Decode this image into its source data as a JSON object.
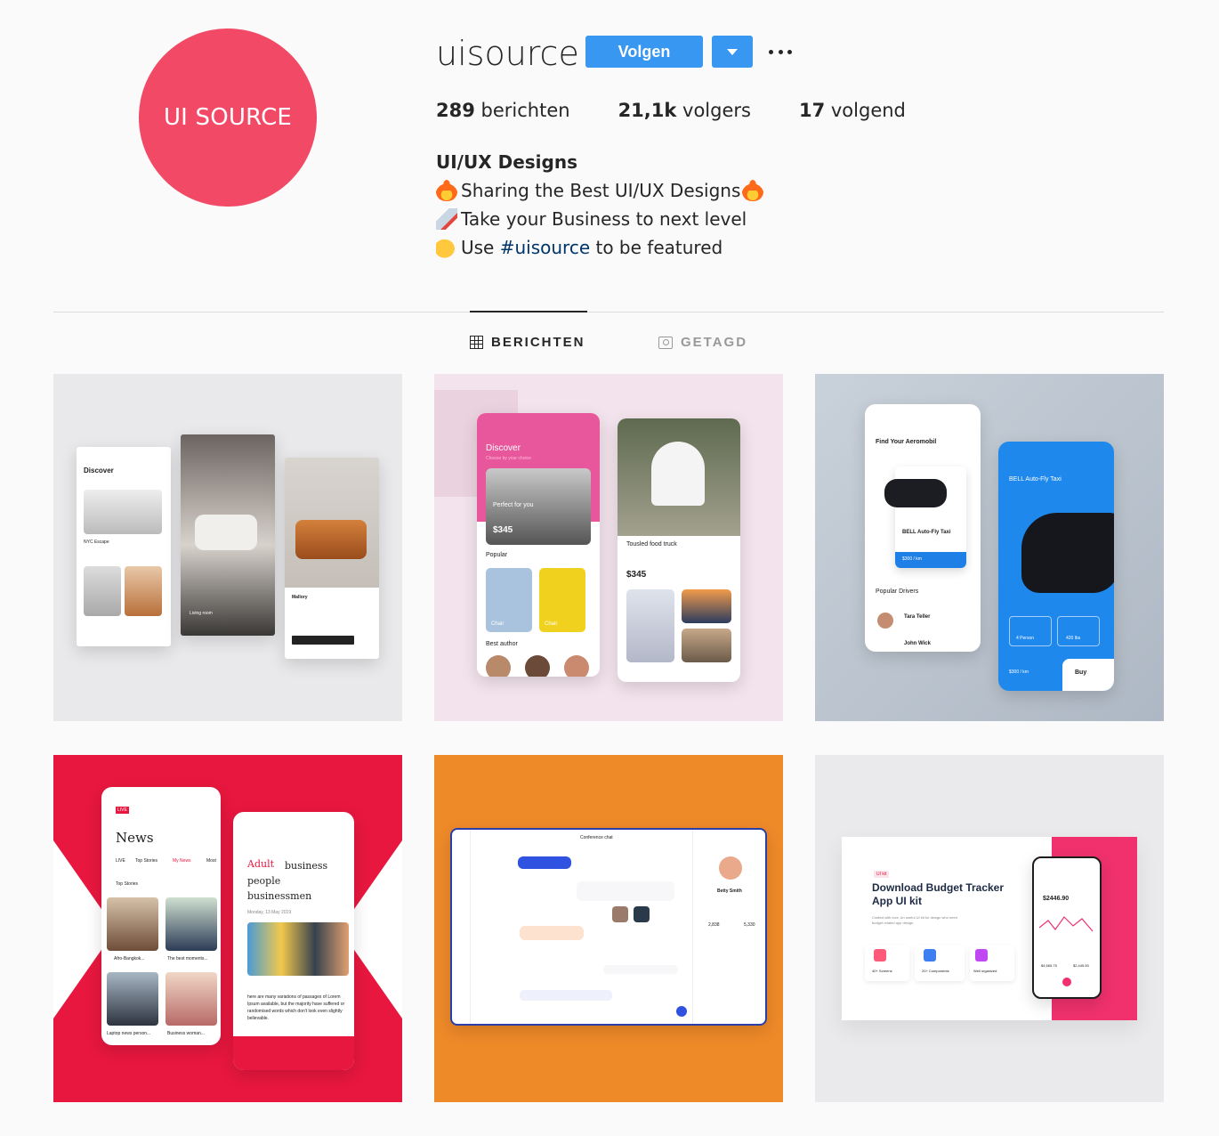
{
  "profile": {
    "avatar_text": "UI SOURCE",
    "username": "uisource",
    "follow_label": "Volgen",
    "stats": {
      "posts_count": "289",
      "posts_label": " berichten",
      "followers_count": "21,1k",
      "followers_label": " volgers",
      "following_count": "17",
      "following_label": " volgend"
    },
    "bio": {
      "name": "UI/UX Designs",
      "line1": "Sharing the Best UI/UX Designs",
      "line2": "Take your Business to next level",
      "line3_prefix": "Use ",
      "line3_hashtag": "#uisource",
      "line3_suffix": " to be featured"
    }
  },
  "tabs": {
    "posts": "BERICHTEN",
    "tagged": "GETAGD"
  },
  "posts": [
    {
      "screen1_title": "Discover",
      "screen1_caption": "NYC Escape",
      "screen2_label": "Living room",
      "screen3_label": "Mallory"
    },
    {
      "discover_title": "Discover",
      "discover_sub": "Choose by your choice",
      "card_title": "Perfect for you",
      "card_price": "$345",
      "popular": "Popular",
      "chair1": "Chair",
      "chair2": "Chair",
      "best_author": "Best author",
      "product_title": "Tousled food truck",
      "product_price": "$345"
    },
    {
      "find_title": "Find Your Aeromobil",
      "product_name": "BELL Auto-Fly Taxi",
      "price": "$300 / km",
      "popular_drivers": "Popular Drivers",
      "driver1": "Tara Teller",
      "driver2": "John Wick",
      "blue_title": "BELL Auto-Fly Taxi",
      "blue_price": "$300 / km",
      "buy": "Buy",
      "person": "4 Person",
      "weight": "420 lbs"
    },
    {
      "live": "LIVE",
      "news_title": "News",
      "tabs": [
        "LIVE",
        "Top Stories",
        "My News",
        "Most"
      ],
      "top_stories": "Top Stories",
      "item1": "Afro-Bangkok...",
      "item2": "The best moments...",
      "item3": "Laptop news person...",
      "item4": "Business woman...",
      "article_highlight": "Adult",
      "article_title_rest": "business people businessmen",
      "date": "Monday, 13 May 2019",
      "body": "here are many variations of passages of Lorem Ipsum available, but the majority have suffered or randomised words which don't look even slightly believable."
    },
    {
      "chat_title": "Conference chat",
      "contact_name": "Betty Smith",
      "stat1": "2,838",
      "stat2": "5,330"
    },
    {
      "tag": "UI kit",
      "title": "Download Budget Tracker App UI kit",
      "desc": "Crafted with love. An useful UI kit for design who need budget related app design.",
      "feature1": "40+ Screens",
      "feature2": "20+ Components",
      "feature3": "Well organized",
      "balance": "$2446.90",
      "stat_a": "$4,565.75",
      "stat_b": "$2,445.50"
    }
  ],
  "colors": {
    "accent": "#3897f0",
    "avatar": "#f24a66",
    "hashtag": "#003569",
    "news_red": "#e8173f",
    "orange": "#ef8a29"
  }
}
